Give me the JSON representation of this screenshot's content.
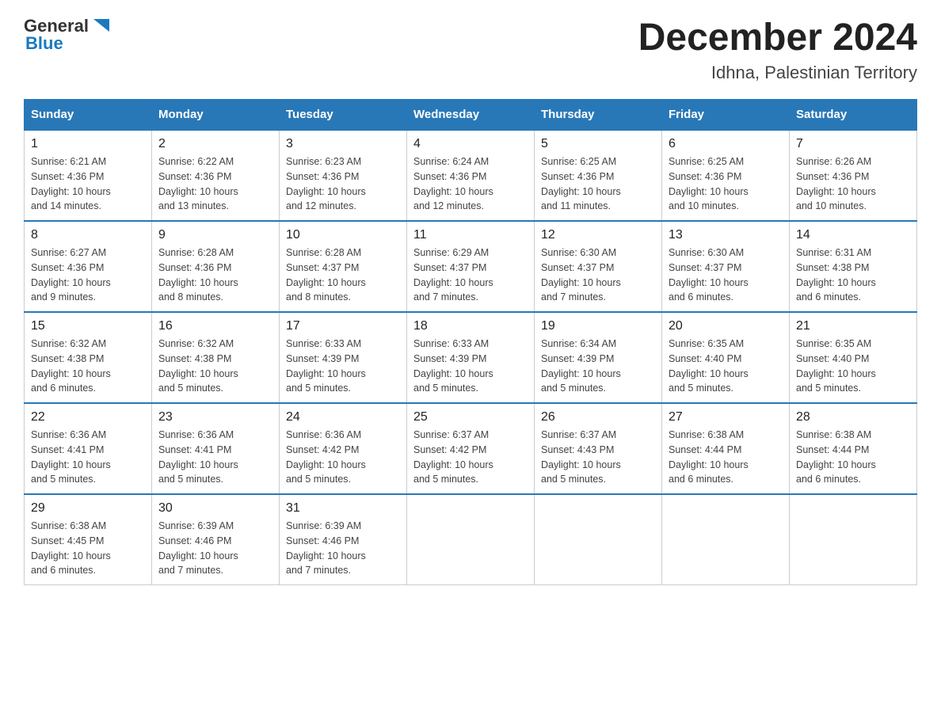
{
  "header": {
    "logo": {
      "general": "General",
      "blue": "Blue"
    },
    "title": "December 2024",
    "location": "Idhna, Palestinian Territory"
  },
  "days_of_week": [
    "Sunday",
    "Monday",
    "Tuesday",
    "Wednesday",
    "Thursday",
    "Friday",
    "Saturday"
  ],
  "weeks": [
    [
      {
        "day": "1",
        "sunrise": "6:21 AM",
        "sunset": "4:36 PM",
        "daylight": "10 hours and 14 minutes."
      },
      {
        "day": "2",
        "sunrise": "6:22 AM",
        "sunset": "4:36 PM",
        "daylight": "10 hours and 13 minutes."
      },
      {
        "day": "3",
        "sunrise": "6:23 AM",
        "sunset": "4:36 PM",
        "daylight": "10 hours and 12 minutes."
      },
      {
        "day": "4",
        "sunrise": "6:24 AM",
        "sunset": "4:36 PM",
        "daylight": "10 hours and 12 minutes."
      },
      {
        "day": "5",
        "sunrise": "6:25 AM",
        "sunset": "4:36 PM",
        "daylight": "10 hours and 11 minutes."
      },
      {
        "day": "6",
        "sunrise": "6:25 AM",
        "sunset": "4:36 PM",
        "daylight": "10 hours and 10 minutes."
      },
      {
        "day": "7",
        "sunrise": "6:26 AM",
        "sunset": "4:36 PM",
        "daylight": "10 hours and 10 minutes."
      }
    ],
    [
      {
        "day": "8",
        "sunrise": "6:27 AM",
        "sunset": "4:36 PM",
        "daylight": "10 hours and 9 minutes."
      },
      {
        "day": "9",
        "sunrise": "6:28 AM",
        "sunset": "4:36 PM",
        "daylight": "10 hours and 8 minutes."
      },
      {
        "day": "10",
        "sunrise": "6:28 AM",
        "sunset": "4:37 PM",
        "daylight": "10 hours and 8 minutes."
      },
      {
        "day": "11",
        "sunrise": "6:29 AM",
        "sunset": "4:37 PM",
        "daylight": "10 hours and 7 minutes."
      },
      {
        "day": "12",
        "sunrise": "6:30 AM",
        "sunset": "4:37 PM",
        "daylight": "10 hours and 7 minutes."
      },
      {
        "day": "13",
        "sunrise": "6:30 AM",
        "sunset": "4:37 PM",
        "daylight": "10 hours and 6 minutes."
      },
      {
        "day": "14",
        "sunrise": "6:31 AM",
        "sunset": "4:38 PM",
        "daylight": "10 hours and 6 minutes."
      }
    ],
    [
      {
        "day": "15",
        "sunrise": "6:32 AM",
        "sunset": "4:38 PM",
        "daylight": "10 hours and 6 minutes."
      },
      {
        "day": "16",
        "sunrise": "6:32 AM",
        "sunset": "4:38 PM",
        "daylight": "10 hours and 5 minutes."
      },
      {
        "day": "17",
        "sunrise": "6:33 AM",
        "sunset": "4:39 PM",
        "daylight": "10 hours and 5 minutes."
      },
      {
        "day": "18",
        "sunrise": "6:33 AM",
        "sunset": "4:39 PM",
        "daylight": "10 hours and 5 minutes."
      },
      {
        "day": "19",
        "sunrise": "6:34 AM",
        "sunset": "4:39 PM",
        "daylight": "10 hours and 5 minutes."
      },
      {
        "day": "20",
        "sunrise": "6:35 AM",
        "sunset": "4:40 PM",
        "daylight": "10 hours and 5 minutes."
      },
      {
        "day": "21",
        "sunrise": "6:35 AM",
        "sunset": "4:40 PM",
        "daylight": "10 hours and 5 minutes."
      }
    ],
    [
      {
        "day": "22",
        "sunrise": "6:36 AM",
        "sunset": "4:41 PM",
        "daylight": "10 hours and 5 minutes."
      },
      {
        "day": "23",
        "sunrise": "6:36 AM",
        "sunset": "4:41 PM",
        "daylight": "10 hours and 5 minutes."
      },
      {
        "day": "24",
        "sunrise": "6:36 AM",
        "sunset": "4:42 PM",
        "daylight": "10 hours and 5 minutes."
      },
      {
        "day": "25",
        "sunrise": "6:37 AM",
        "sunset": "4:42 PM",
        "daylight": "10 hours and 5 minutes."
      },
      {
        "day": "26",
        "sunrise": "6:37 AM",
        "sunset": "4:43 PM",
        "daylight": "10 hours and 5 minutes."
      },
      {
        "day": "27",
        "sunrise": "6:38 AM",
        "sunset": "4:44 PM",
        "daylight": "10 hours and 6 minutes."
      },
      {
        "day": "28",
        "sunrise": "6:38 AM",
        "sunset": "4:44 PM",
        "daylight": "10 hours and 6 minutes."
      }
    ],
    [
      {
        "day": "29",
        "sunrise": "6:38 AM",
        "sunset": "4:45 PM",
        "daylight": "10 hours and 6 minutes."
      },
      {
        "day": "30",
        "sunrise": "6:39 AM",
        "sunset": "4:46 PM",
        "daylight": "10 hours and 7 minutes."
      },
      {
        "day": "31",
        "sunrise": "6:39 AM",
        "sunset": "4:46 PM",
        "daylight": "10 hours and 7 minutes."
      },
      null,
      null,
      null,
      null
    ]
  ],
  "labels": {
    "sunrise": "Sunrise:",
    "sunset": "Sunset:",
    "daylight": "Daylight:"
  }
}
